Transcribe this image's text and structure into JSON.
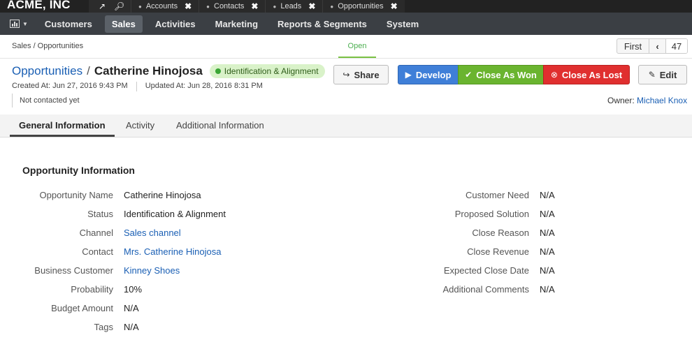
{
  "brand": "ACME, INC",
  "history_tabs": [
    {
      "label": "Accounts"
    },
    {
      "label": "Contacts"
    },
    {
      "label": "Leads"
    },
    {
      "label": "Opportunities"
    }
  ],
  "nav": {
    "items": [
      "Customers",
      "Sales",
      "Activities",
      "Marketing",
      "Reports & Segments",
      "System"
    ],
    "active": "Sales"
  },
  "breadcrumb": "Sales / Opportunities",
  "status_step": "Open",
  "pager": {
    "first": "First",
    "prev": "‹",
    "number": "47"
  },
  "header": {
    "link": "Opportunities",
    "separator": "/",
    "name": "Catherine Hinojosa",
    "badge": "Identification & Alignment",
    "created": "Created At: Jun 27, 2016 9:43 PM",
    "updated": "Updated At: Jun 28, 2016 8:31 PM",
    "contact_status": "Not contacted yet",
    "owner_label": "Owner:",
    "owner_name": "Michael Knox"
  },
  "actions": {
    "share": "Share",
    "develop": "Develop",
    "close_won": "Close As Won",
    "close_lost": "Close As Lost",
    "edit": "Edit"
  },
  "tabs": [
    "General Information",
    "Activity",
    "Additional Information"
  ],
  "section": {
    "title": "Opportunity Information",
    "left": [
      {
        "label": "Opportunity Name",
        "value": "Catherine Hinojosa",
        "link": false
      },
      {
        "label": "Status",
        "value": "Identification & Alignment",
        "link": false
      },
      {
        "label": "Channel",
        "value": "Sales channel",
        "link": true
      },
      {
        "label": "Contact",
        "value": "Mrs. Catherine Hinojosa",
        "link": true
      },
      {
        "label": "Business Customer",
        "value": "Kinney Shoes",
        "link": true
      },
      {
        "label": "Probability",
        "value": "10%",
        "link": false
      },
      {
        "label": "Budget Amount",
        "value": "N/A",
        "link": false
      },
      {
        "label": "Tags",
        "value": "N/A",
        "link": false
      }
    ],
    "right": [
      {
        "label": "Customer Need",
        "value": "N/A"
      },
      {
        "label": "Proposed Solution",
        "value": "N/A"
      },
      {
        "label": "Close Reason",
        "value": "N/A"
      },
      {
        "label": "Close Revenue",
        "value": "N/A"
      },
      {
        "label": "Expected Close Date",
        "value": "N/A"
      },
      {
        "label": "Additional Comments",
        "value": "N/A"
      }
    ]
  }
}
